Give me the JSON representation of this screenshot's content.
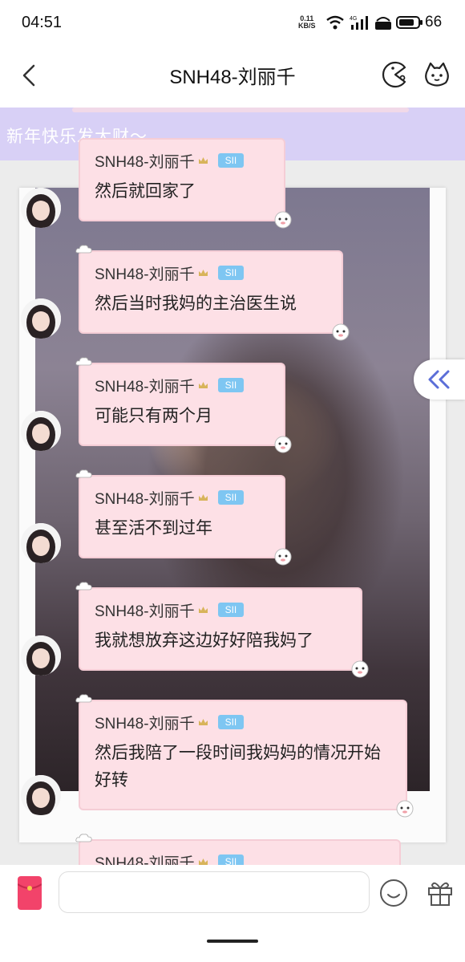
{
  "status_bar": {
    "time": "04:51",
    "net_speed_value": "0.11",
    "net_speed_unit": "KB/S",
    "network": "4G",
    "battery": "66"
  },
  "header": {
    "title": "SNH48-刘丽千",
    "back_icon": "chevron-left-icon",
    "game_icon": "pacman-icon",
    "profile_icon": "pet-face-icon"
  },
  "notice": {
    "text": "新年快乐发大财～"
  },
  "messages": [
    {
      "sender": "SNH48-刘丽千",
      "team": "SII",
      "text": "然后就回家了"
    },
    {
      "sender": "SNH48-刘丽千",
      "team": "SII",
      "text": "然后当时我妈的主治医生说"
    },
    {
      "sender": "SNH48-刘丽千",
      "team": "SII",
      "text": "可能只有两个月"
    },
    {
      "sender": "SNH48-刘丽千",
      "team": "SII",
      "text": "甚至活不到过年"
    },
    {
      "sender": "SNH48-刘丽千",
      "team": "SII",
      "text": "我就想放弃这边好好陪我妈了"
    },
    {
      "sender": "SNH48-刘丽千",
      "team": "SII",
      "text": "然后我陪了一段时间我妈妈的情况开始好转"
    },
    {
      "sender": "SNH48-刘丽千",
      "team": "SII",
      "text": ""
    }
  ],
  "input": {
    "value": "",
    "placeholder": ""
  },
  "colors": {
    "bubble_bg": "#fde0e6",
    "team_badge": "#7ec6f2",
    "notice_bg": "#d6cef6",
    "redpacket": "#f2436a",
    "side_button_icon": "#5b6ed8"
  }
}
